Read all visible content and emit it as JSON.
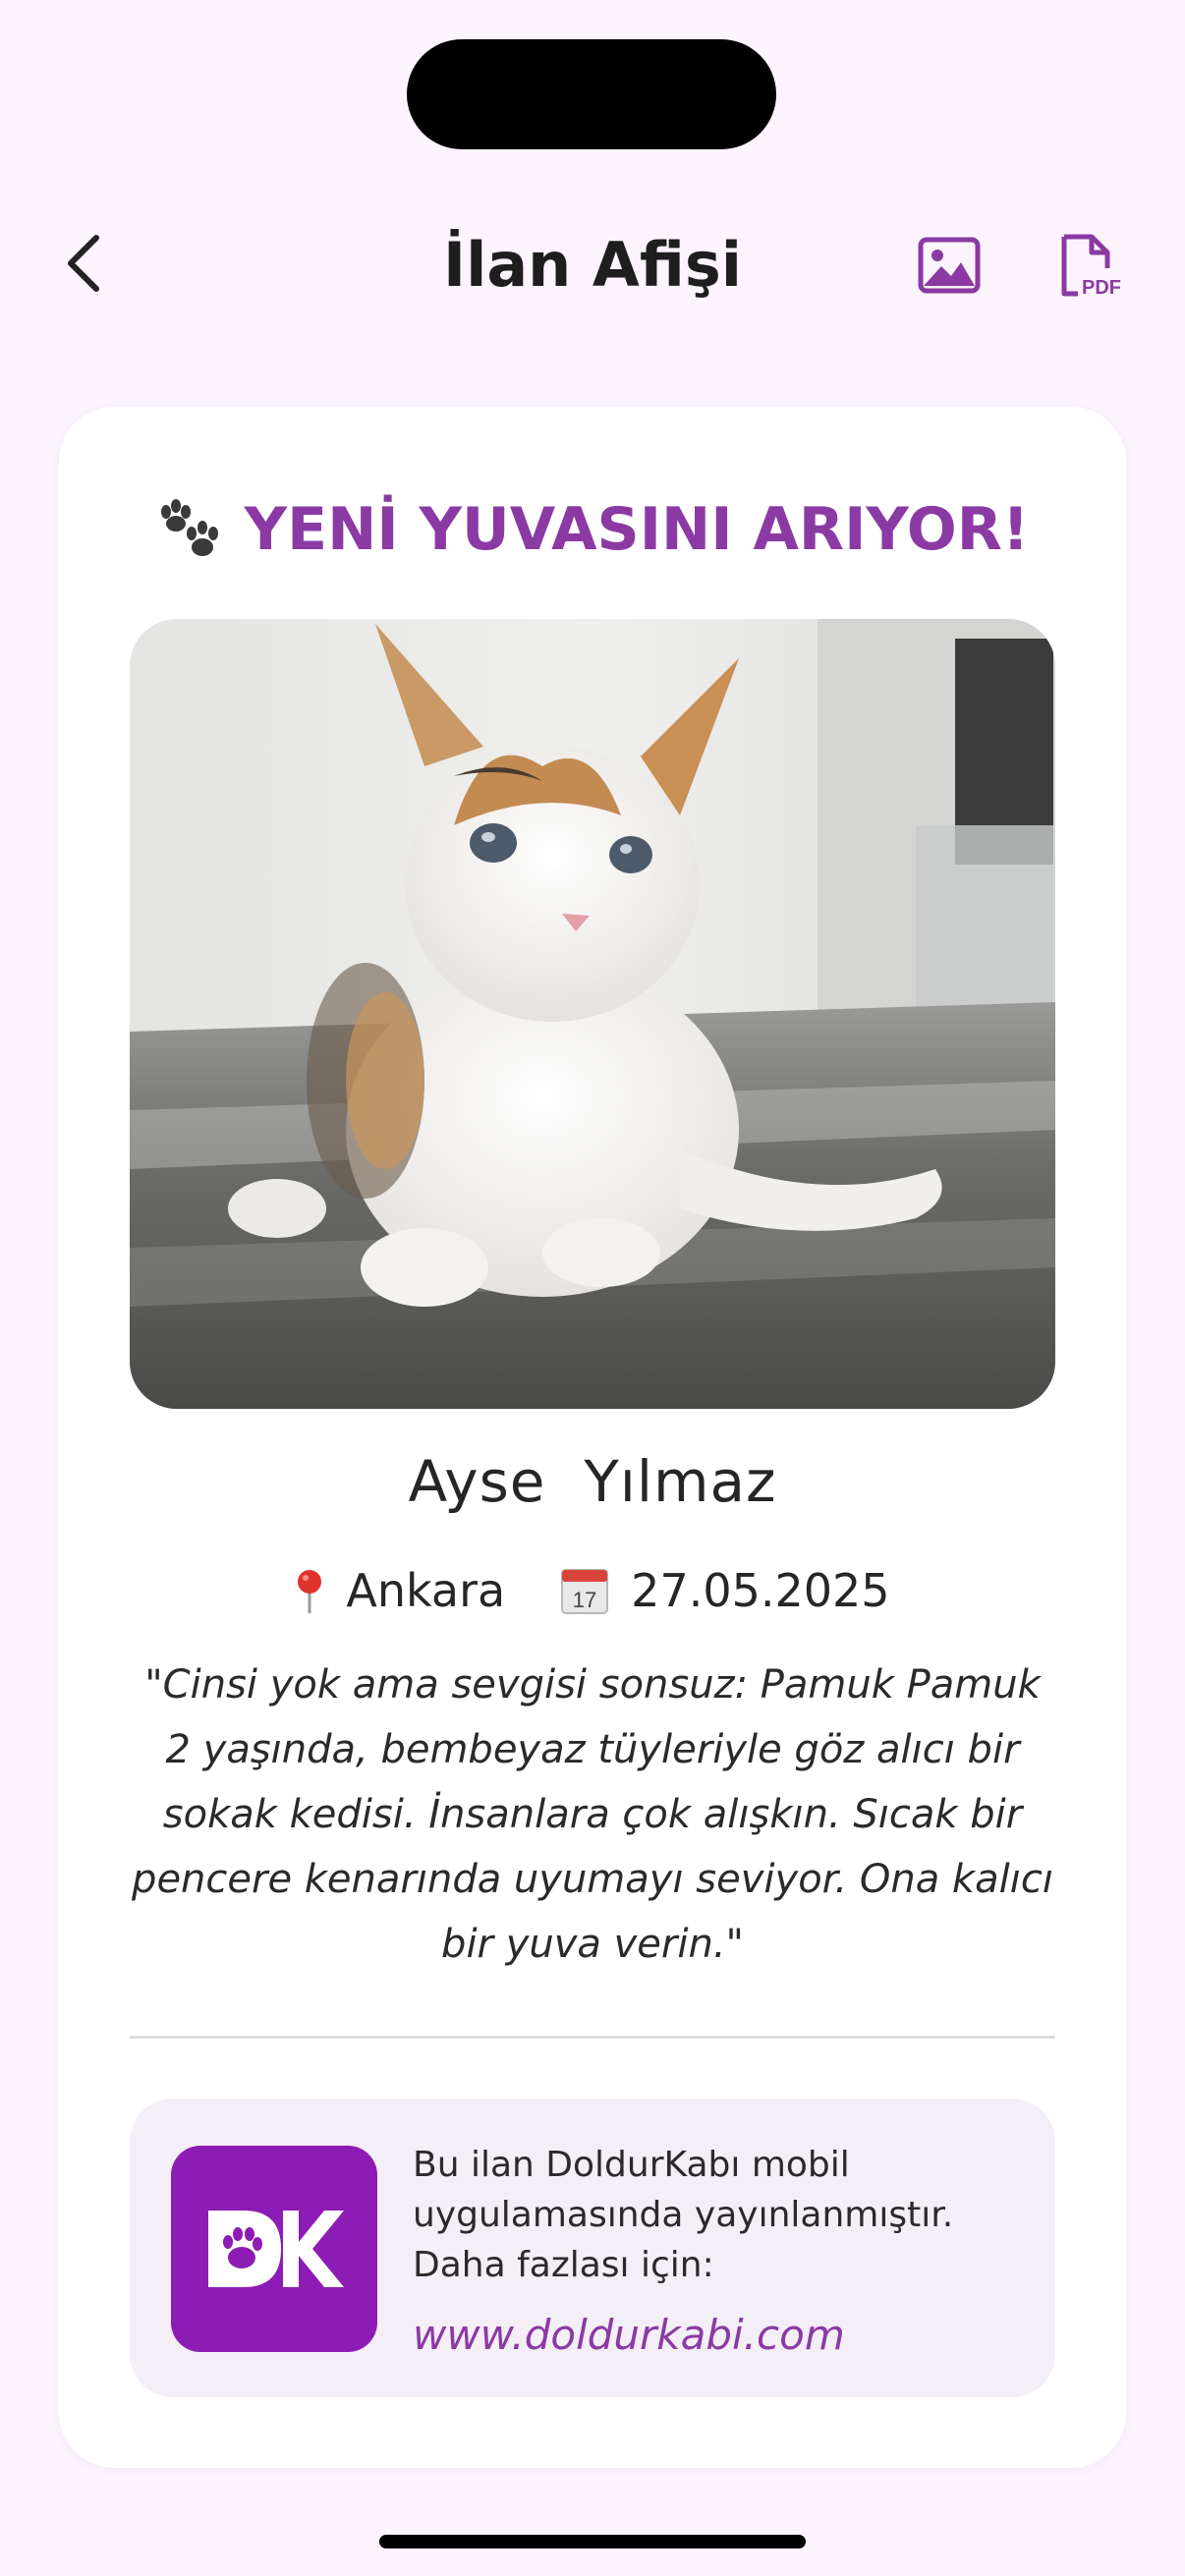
{
  "header": {
    "title": "İlan Afişi",
    "back_icon": "chevron-left-icon",
    "image_icon": "image-icon",
    "pdf_icon": "pdf-file-icon",
    "pdf_icon_text": "PDF"
  },
  "poster": {
    "heading": "YENİ YUVASINI ARIYOR!",
    "heading_icon": "paw-prints-icon",
    "photo_alt": "kitten photo",
    "owner_name": "Ayse  Yılmaz",
    "location_icon": "pin-icon",
    "location": "Ankara",
    "date_icon": "calendar-icon",
    "date": "27.05.2025",
    "description": "\"Cinsi yok ama sevgisi sonsuz: Pamuk Pamuk 2 yaşında, bembeyaz tüyleriyle göz alıcı bir sokak kedisi. İnsanlara çok alışkın. Sıcak bir pencere kenarında uyumayı seviyor. Ona kalıcı bir yuva verin.\""
  },
  "footer": {
    "logo_text": "DK",
    "info_text": "Bu ilan DoldurKabı mobil uygulamasında yayınlanmıştır. Daha fazlası için:",
    "link": "www.doldurkabi.com"
  },
  "colors": {
    "accent": "#8b3aa4",
    "logo_bg": "#8c1cb4",
    "background": "#fbf4fc",
    "footer_bg": "#f4eef6"
  }
}
